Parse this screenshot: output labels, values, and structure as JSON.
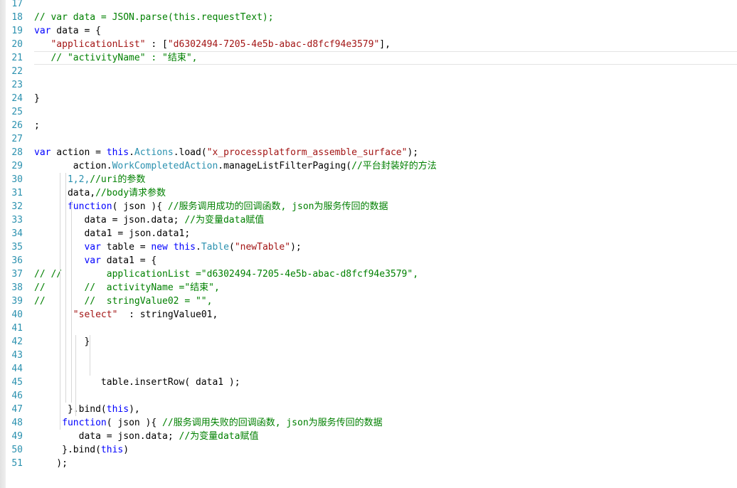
{
  "editor": {
    "line_numbers": [
      "17",
      "18",
      "19",
      "20",
      "21",
      "22",
      "23",
      "24",
      "25",
      "26",
      "27",
      "28",
      "29",
      "30",
      "31",
      "32",
      "33",
      "34",
      "35",
      "36",
      "37",
      "38",
      "39",
      "40",
      "41",
      "42",
      "43",
      "44",
      "45",
      "46",
      "47",
      "48",
      "49",
      "50",
      "51"
    ],
    "current_line": "21",
    "lines": [
      {
        "n": "17",
        "tokens": []
      },
      {
        "n": "18",
        "tokens": [
          {
            "c": "c",
            "t": "// var data = JSON.parse(this.requestText);"
          }
        ]
      },
      {
        "n": "19",
        "tokens": [
          {
            "c": "k",
            "t": "var"
          },
          {
            "c": "p",
            "t": " data = {"
          }
        ]
      },
      {
        "n": "20",
        "tokens": [
          {
            "c": "p",
            "t": "   "
          },
          {
            "c": "s",
            "t": "\"applicationList\""
          },
          {
            "c": "p",
            "t": " : ["
          },
          {
            "c": "s",
            "t": "\"d6302494-7205-4e5b-abac-d8fcf94e3579\""
          },
          {
            "c": "p",
            "t": "],"
          }
        ]
      },
      {
        "n": "21",
        "tokens": [
          {
            "c": "p",
            "t": "   "
          },
          {
            "c": "c",
            "t": "// \"activityName\" : \"结束\","
          }
        ]
      },
      {
        "n": "22",
        "tokens": []
      },
      {
        "n": "23",
        "tokens": []
      },
      {
        "n": "24",
        "tokens": [
          {
            "c": "p",
            "t": "}"
          }
        ]
      },
      {
        "n": "25",
        "tokens": []
      },
      {
        "n": "26",
        "tokens": [
          {
            "c": "p",
            "t": ";"
          }
        ]
      },
      {
        "n": "27",
        "tokens": []
      },
      {
        "n": "28",
        "tokens": [
          {
            "c": "k",
            "t": "var"
          },
          {
            "c": "p",
            "t": " action = "
          },
          {
            "c": "k",
            "t": "this"
          },
          {
            "c": "p",
            "t": "."
          },
          {
            "c": "y",
            "t": "Actions"
          },
          {
            "c": "p",
            "t": ".load("
          },
          {
            "c": "s",
            "t": "\"x_processplatform_assemble_surface\""
          },
          {
            "c": "p",
            "t": ");"
          }
        ]
      },
      {
        "n": "29",
        "tokens": [
          {
            "c": "p",
            "t": "       action."
          },
          {
            "c": "y",
            "t": "WorkCompletedAction"
          },
          {
            "c": "p",
            "t": ".manageListFilterPaging("
          },
          {
            "c": "c",
            "t": "//平台封装好的方法"
          }
        ]
      },
      {
        "n": "30",
        "tokens": [
          {
            "c": "p",
            "t": "      "
          },
          {
            "c": "y",
            "t": "1,2,"
          },
          {
            "c": "c",
            "t": "//uri的参数"
          }
        ]
      },
      {
        "n": "31",
        "tokens": [
          {
            "c": "p",
            "t": "      data,"
          },
          {
            "c": "c",
            "t": "//body请求参数"
          }
        ]
      },
      {
        "n": "32",
        "tokens": [
          {
            "c": "p",
            "t": "      "
          },
          {
            "c": "k",
            "t": "function"
          },
          {
            "c": "p",
            "t": "( json ){ "
          },
          {
            "c": "c",
            "t": "//服务调用成功的回调函数, json为服务传回的数据"
          }
        ]
      },
      {
        "n": "33",
        "tokens": [
          {
            "c": "p",
            "t": "         data = json.data; "
          },
          {
            "c": "c",
            "t": "//为变量data赋值"
          }
        ]
      },
      {
        "n": "34",
        "tokens": [
          {
            "c": "p",
            "t": "         data1 = json.data1;"
          }
        ]
      },
      {
        "n": "35",
        "tokens": [
          {
            "c": "p",
            "t": "         "
          },
          {
            "c": "k",
            "t": "var"
          },
          {
            "c": "p",
            "t": " table = "
          },
          {
            "c": "k",
            "t": "new"
          },
          {
            "c": "p",
            "t": " "
          },
          {
            "c": "k",
            "t": "this"
          },
          {
            "c": "p",
            "t": "."
          },
          {
            "c": "y",
            "t": "Table"
          },
          {
            "c": "p",
            "t": "("
          },
          {
            "c": "s",
            "t": "\"newTable\""
          },
          {
            "c": "p",
            "t": ");"
          }
        ]
      },
      {
        "n": "36",
        "tokens": [
          {
            "c": "p",
            "t": "         "
          },
          {
            "c": "k",
            "t": "var"
          },
          {
            "c": "p",
            "t": " data1 = {"
          }
        ]
      },
      {
        "n": "37",
        "tokens": [
          {
            "c": "c",
            "t": "// //        applicationList =\"d6302494-7205-4e5b-abac-d8fcf94e3579\","
          }
        ]
      },
      {
        "n": "38",
        "tokens": [
          {
            "c": "c",
            "t": "//       //  activityName =\"结束\","
          }
        ]
      },
      {
        "n": "39",
        "tokens": [
          {
            "c": "c",
            "t": "//       //  stringValue02 = \"\","
          }
        ]
      },
      {
        "n": "40",
        "tokens": [
          {
            "c": "p",
            "t": "       "
          },
          {
            "c": "s",
            "t": "\"select\""
          },
          {
            "c": "p",
            "t": "  : stringValue01,"
          }
        ]
      },
      {
        "n": "41",
        "tokens": []
      },
      {
        "n": "42",
        "tokens": [
          {
            "c": "p",
            "t": "         }"
          }
        ]
      },
      {
        "n": "43",
        "tokens": []
      },
      {
        "n": "44",
        "tokens": []
      },
      {
        "n": "45",
        "tokens": [
          {
            "c": "p",
            "t": "            table.insertRow( data1 );"
          }
        ]
      },
      {
        "n": "46",
        "tokens": []
      },
      {
        "n": "47",
        "tokens": [
          {
            "c": "p",
            "t": "      }.bind("
          },
          {
            "c": "k",
            "t": "this"
          },
          {
            "c": "p",
            "t": "),"
          }
        ]
      },
      {
        "n": "48",
        "tokens": [
          {
            "c": "p",
            "t": "     "
          },
          {
            "c": "k",
            "t": "function"
          },
          {
            "c": "p",
            "t": "( json ){ "
          },
          {
            "c": "c",
            "t": "//服务调用失败的回调函数, json为服务传回的数据"
          }
        ]
      },
      {
        "n": "49",
        "tokens": [
          {
            "c": "p",
            "t": "        data = json.data; "
          },
          {
            "c": "c",
            "t": "//为变量data赋值"
          }
        ]
      },
      {
        "n": "50",
        "tokens": [
          {
            "c": "p",
            "t": "     }.bind("
          },
          {
            "c": "k",
            "t": "this"
          },
          {
            "c": "p",
            "t": ")"
          }
        ]
      },
      {
        "n": "51",
        "tokens": [
          {
            "c": "p",
            "t": "    );"
          }
        ]
      }
    ]
  }
}
